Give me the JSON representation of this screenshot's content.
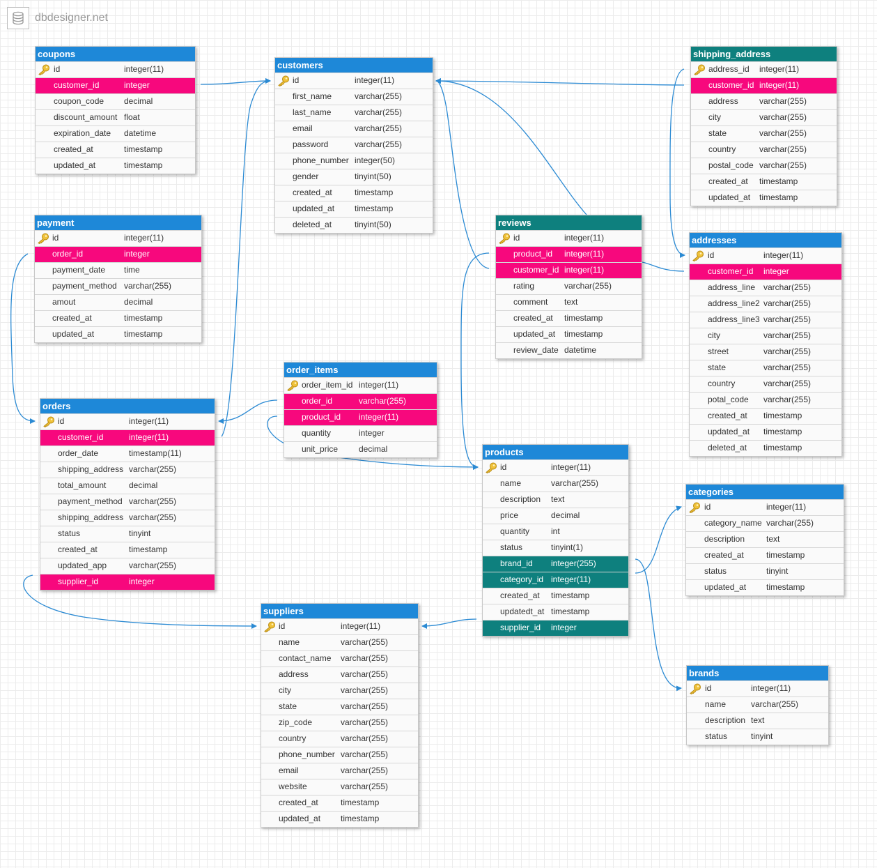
{
  "app": {
    "title": "dbdesigner.net",
    "logo_icon": "database-icon"
  },
  "colors": {
    "header_blue": "#1e88d8",
    "header_teal": "#0e807e",
    "fk_pink": "#f7087d",
    "fk_teal": "#0e807e",
    "wire": "#2b8ad3"
  },
  "tables": [
    {
      "name": "coupons",
      "header_color": "blue",
      "columns": [
        {
          "name": "id",
          "type": "integer(11)",
          "pk": true
        },
        {
          "name": "customer_id",
          "type": "integer",
          "fk": "pink"
        },
        {
          "name": "coupon_code",
          "type": "decimal"
        },
        {
          "name": "discount_amount",
          "type": "float"
        },
        {
          "name": "expiration_date",
          "type": "datetime"
        },
        {
          "name": "created_at",
          "type": "timestamp"
        },
        {
          "name": "updated_at",
          "type": "timestamp"
        }
      ]
    },
    {
      "name": "customers",
      "header_color": "blue",
      "columns": [
        {
          "name": "id",
          "type": "integer(11)",
          "pk": true
        },
        {
          "name": "first_name",
          "type": "varchar(255)"
        },
        {
          "name": "last_name",
          "type": "varchar(255)"
        },
        {
          "name": "email",
          "type": "varchar(255)"
        },
        {
          "name": "password",
          "type": "varchar(255)"
        },
        {
          "name": "phone_number",
          "type": "integer(50)"
        },
        {
          "name": "gender",
          "type": "tinyint(50)"
        },
        {
          "name": "created_at",
          "type": "timestamp"
        },
        {
          "name": "updated_at",
          "type": "timestamp"
        },
        {
          "name": "deleted_at",
          "type": "tinyint(50)"
        }
      ]
    },
    {
      "name": "shipping_address",
      "header_color": "teal",
      "columns": [
        {
          "name": "address_id",
          "type": "integer(11)",
          "pk": true
        },
        {
          "name": "customer_id",
          "type": "integer(11)",
          "fk": "pink"
        },
        {
          "name": "address",
          "type": "varchar(255)"
        },
        {
          "name": "city",
          "type": "varchar(255)"
        },
        {
          "name": "state",
          "type": "varchar(255)"
        },
        {
          "name": "country",
          "type": "varchar(255)"
        },
        {
          "name": "postal_code",
          "type": "varchar(255)"
        },
        {
          "name": "created_at",
          "type": "timestamp"
        },
        {
          "name": "updated_at",
          "type": "timestamp"
        }
      ]
    },
    {
      "name": "payment",
      "header_color": "blue",
      "columns": [
        {
          "name": "id",
          "type": "integer(11)",
          "pk": true
        },
        {
          "name": "order_id",
          "type": "integer",
          "fk": "pink"
        },
        {
          "name": "payment_date",
          "type": "time"
        },
        {
          "name": "payment_method",
          "type": "varchar(255)"
        },
        {
          "name": "amout",
          "type": "decimal"
        },
        {
          "name": "created_at",
          "type": "timestamp"
        },
        {
          "name": "updated_at",
          "type": "timestamp"
        }
      ]
    },
    {
      "name": "reviews",
      "header_color": "teal",
      "columns": [
        {
          "name": "id",
          "type": "integer(11)",
          "pk": true
        },
        {
          "name": "product_id",
          "type": "integer(11)",
          "fk": "pink"
        },
        {
          "name": "customer_id",
          "type": "integer(11)",
          "fk": "pink"
        },
        {
          "name": "rating",
          "type": "varchar(255)"
        },
        {
          "name": "comment",
          "type": "text"
        },
        {
          "name": "created_at",
          "type": "timestamp"
        },
        {
          "name": "updated_at",
          "type": "timestamp"
        },
        {
          "name": "review_date",
          "type": "datetime"
        }
      ]
    },
    {
      "name": "addresses",
      "header_color": "blue",
      "columns": [
        {
          "name": "id",
          "type": "integer(11)",
          "pk": true
        },
        {
          "name": "customer_id",
          "type": "integer",
          "fk": "pink"
        },
        {
          "name": "address_line",
          "type": "varchar(255)"
        },
        {
          "name": "address_line2",
          "type": "varchar(255)"
        },
        {
          "name": "address_line3",
          "type": "varchar(255)"
        },
        {
          "name": "city",
          "type": "varchar(255)"
        },
        {
          "name": "street",
          "type": "varchar(255)"
        },
        {
          "name": "state",
          "type": "varchar(255)"
        },
        {
          "name": "country",
          "type": "varchar(255)"
        },
        {
          "name": "potal_code",
          "type": "varchar(255)"
        },
        {
          "name": "created_at",
          "type": "timestamp"
        },
        {
          "name": "updated_at",
          "type": "timestamp"
        },
        {
          "name": "deleted_at",
          "type": "timestamp"
        }
      ]
    },
    {
      "name": "order_items",
      "header_color": "blue",
      "columns": [
        {
          "name": "order_item_id",
          "type": "integer(11)",
          "pk": true
        },
        {
          "name": "order_id",
          "type": "varchar(255)",
          "fk": "pink"
        },
        {
          "name": "product_id",
          "type": "integer(11)",
          "fk": "pink"
        },
        {
          "name": "quantity",
          "type": "integer"
        },
        {
          "name": "unit_price",
          "type": "decimal"
        }
      ]
    },
    {
      "name": "orders",
      "header_color": "blue",
      "columns": [
        {
          "name": "id",
          "type": "integer(11)",
          "pk": true
        },
        {
          "name": "customer_id",
          "type": "integer(11)",
          "fk": "pink"
        },
        {
          "name": "order_date",
          "type": "timestamp(11)"
        },
        {
          "name": "shipping_address",
          "type": "varchar(255)"
        },
        {
          "name": "total_amount",
          "type": "decimal"
        },
        {
          "name": "payment_method",
          "type": "varchar(255)"
        },
        {
          "name": "shipping_address",
          "type": "varchar(255)"
        },
        {
          "name": "status",
          "type": "tinyint"
        },
        {
          "name": "created_at",
          "type": "timestamp"
        },
        {
          "name": "updated_app",
          "type": "varchar(255)"
        },
        {
          "name": "supplier_id",
          "type": "integer",
          "fk": "pink"
        }
      ]
    },
    {
      "name": "products",
      "header_color": "blue",
      "columns": [
        {
          "name": "id",
          "type": "integer(11)",
          "pk": true
        },
        {
          "name": "name",
          "type": "varchar(255)"
        },
        {
          "name": "description",
          "type": "text"
        },
        {
          "name": "price",
          "type": "decimal"
        },
        {
          "name": "quantity",
          "type": "int"
        },
        {
          "name": "status",
          "type": "tinyint(1)"
        },
        {
          "name": "brand_id",
          "type": "integer(255)",
          "fk": "teal"
        },
        {
          "name": "category_id",
          "type": "integer(11)",
          "fk": "teal"
        },
        {
          "name": "created_at",
          "type": "timestamp"
        },
        {
          "name": "updatedt_at",
          "type": "timestamp"
        },
        {
          "name": "supplier_id",
          "type": "integer",
          "fk": "teal"
        }
      ]
    },
    {
      "name": "categories",
      "header_color": "blue",
      "columns": [
        {
          "name": "id",
          "type": "integer(11)",
          "pk": true
        },
        {
          "name": "category_name",
          "type": "varchar(255)"
        },
        {
          "name": "description",
          "type": "text"
        },
        {
          "name": "created_at",
          "type": "timestamp"
        },
        {
          "name": "status",
          "type": "tinyint"
        },
        {
          "name": "updated_at",
          "type": "timestamp"
        }
      ]
    },
    {
      "name": "suppliers",
      "header_color": "blue",
      "columns": [
        {
          "name": "id",
          "type": "integer(11)",
          "pk": true
        },
        {
          "name": "name",
          "type": "varchar(255)"
        },
        {
          "name": "contact_name",
          "type": "varchar(255)"
        },
        {
          "name": "address",
          "type": "varchar(255)"
        },
        {
          "name": "city",
          "type": "varchar(255)"
        },
        {
          "name": "state",
          "type": "varchar(255)"
        },
        {
          "name": "zip_code",
          "type": "varchar(255)"
        },
        {
          "name": "country",
          "type": "varchar(255)"
        },
        {
          "name": "phone_number",
          "type": "varchar(255)"
        },
        {
          "name": "email",
          "type": "varchar(255)"
        },
        {
          "name": "website",
          "type": "varchar(255)"
        },
        {
          "name": "created_at",
          "type": "timestamp"
        },
        {
          "name": "updated_at",
          "type": "timestamp"
        }
      ]
    },
    {
      "name": "brands",
      "header_color": "blue",
      "columns": [
        {
          "name": "id",
          "type": "integer(11)",
          "pk": true
        },
        {
          "name": "name",
          "type": "varchar(255)"
        },
        {
          "name": "description",
          "type": "text"
        },
        {
          "name": "status",
          "type": "tinyint"
        }
      ]
    }
  ],
  "relations": [
    {
      "from": "coupons.customer_id",
      "to": "customers.id"
    },
    {
      "from": "orders.customer_id",
      "to": "customers.id"
    },
    {
      "from": "reviews.customer_id",
      "to": "customers.id"
    },
    {
      "from": "shipping_address.customer_id",
      "to": "customers.id"
    },
    {
      "from": "shipping_address.customer_id",
      "to": "addresses.id"
    },
    {
      "from": "addresses.customer_id",
      "to": "reviews.customer_id"
    },
    {
      "from": "payment.order_id",
      "to": "orders.id"
    },
    {
      "from": "order_items.order_id",
      "to": "orders.id"
    },
    {
      "from": "order_items.product_id",
      "to": "products.id"
    },
    {
      "from": "reviews.product_id",
      "to": "products.id"
    },
    {
      "from": "products.category_id",
      "to": "categories.id"
    },
    {
      "from": "products.brand_id",
      "to": "brands.id"
    },
    {
      "from": "products.supplier_id",
      "to": "suppliers.id"
    },
    {
      "from": "orders.supplier_id",
      "to": "suppliers.id"
    }
  ]
}
